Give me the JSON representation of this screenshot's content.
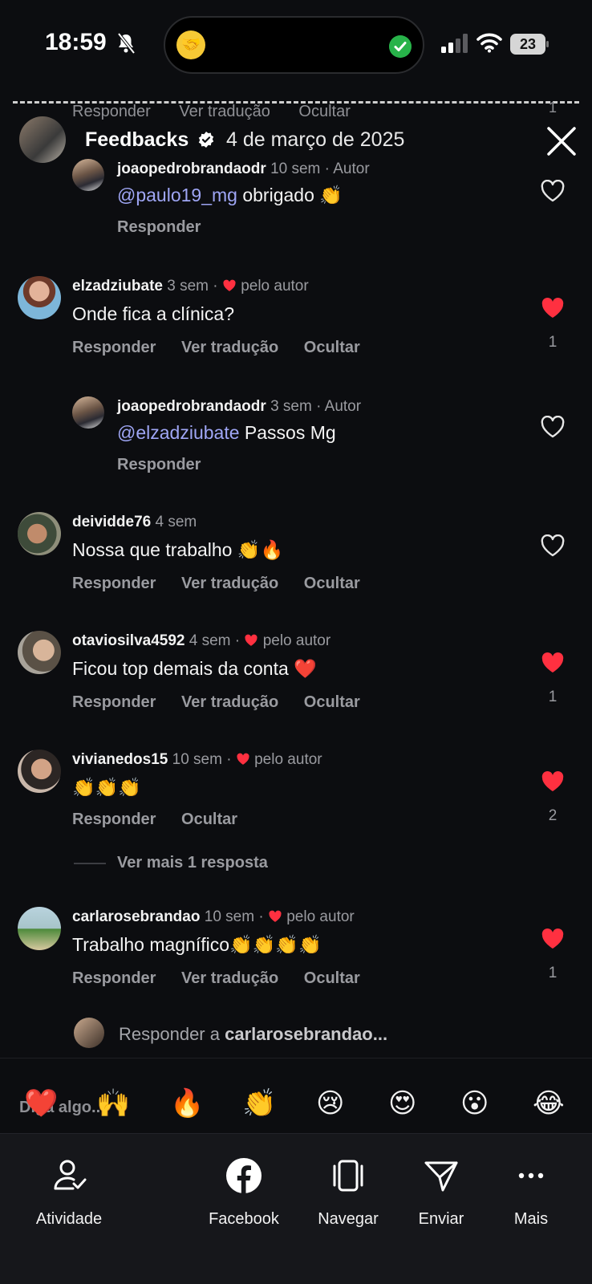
{
  "status_bar": {
    "time": "18:59",
    "battery": "23"
  },
  "header": {
    "ghost_actions": [
      "Responder",
      "Ver tradução",
      "Ocultar"
    ],
    "ghost_count": "1",
    "title": "Feedbacks",
    "date": "4 de março de 2025"
  },
  "comments": [
    {
      "username": "joaopedrobrandaodr",
      "time": "10 sem",
      "tag": "· Autor",
      "mention": "@paulo19_mg",
      "text": " obrigado 👏",
      "actions": [
        "Responder"
      ],
      "liked": false,
      "likes": ""
    },
    {
      "username": "elzadziubate",
      "time": "3 sem",
      "tag": "pelo autor",
      "mention": "",
      "text": "Onde fica a clínica?",
      "actions": [
        "Responder",
        "Ver tradução",
        "Ocultar"
      ],
      "liked": true,
      "likes": "1"
    },
    {
      "username": "joaopedrobrandaodr",
      "time": "3 sem",
      "tag": "· Autor",
      "mention": "@elzadziubate",
      "text": " Passos Mg",
      "actions": [
        "Responder"
      ],
      "liked": false,
      "likes": ""
    },
    {
      "username": "deividde76",
      "time": "4 sem",
      "tag": "",
      "mention": "",
      "text": "Nossa que trabalho 👏🔥",
      "actions": [
        "Responder",
        "Ver tradução",
        "Ocultar"
      ],
      "liked": false,
      "likes": ""
    },
    {
      "username": "otaviosilva4592",
      "time": "4 sem",
      "tag": "pelo autor",
      "mention": "",
      "text": "Ficou top demais da conta ❤️",
      "actions": [
        "Responder",
        "Ver tradução",
        "Ocultar"
      ],
      "liked": true,
      "likes": "1"
    },
    {
      "username": "vivianedos15",
      "time": "10 sem",
      "tag": "pelo autor",
      "mention": "",
      "text": "👏👏👏",
      "actions": [
        "Responder",
        "Ocultar"
      ],
      "liked": true,
      "likes": "2"
    },
    {
      "username": "carlarosebrandao",
      "time": "10 sem",
      "tag": "pelo autor",
      "mention": "",
      "text": "Trabalho magnífico👏👏👏👏",
      "actions": [
        "Responder",
        "Ver tradução",
        "Ocultar"
      ],
      "liked": true,
      "likes": "1"
    }
  ],
  "more_replies": "Ver mais 1 resposta",
  "reply_box": {
    "prefix": "Responder a ",
    "username": "carlarosebrandao..."
  },
  "reactions": [
    "❤️",
    "🙌",
    "🔥",
    "👏",
    "😢",
    "😍",
    "😮",
    "😂"
  ],
  "say_something": "Diga algo...",
  "bottom_nav": [
    {
      "label": "Atividade",
      "icon": "activity-icon"
    },
    {
      "label": "Facebook",
      "icon": "facebook-icon"
    },
    {
      "label": "Navegar",
      "icon": "navigate-icon"
    },
    {
      "label": "Enviar",
      "icon": "send-icon"
    },
    {
      "label": "Mais",
      "icon": "more-icon"
    }
  ],
  "colors": {
    "background": "#0c0d10",
    "like_red": "#ff3040",
    "mention": "#9fa6f5",
    "muted": "#9a9ba0"
  }
}
